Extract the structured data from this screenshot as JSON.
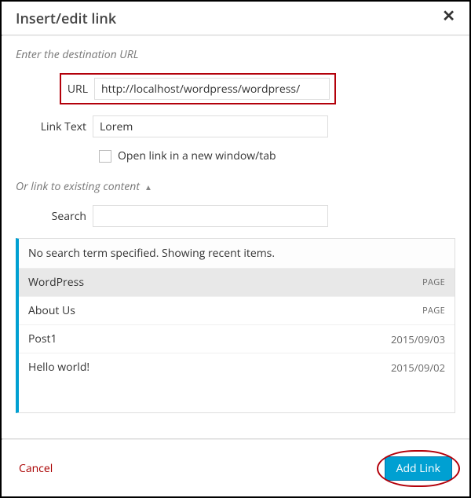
{
  "dialog": {
    "title": "Insert/edit link"
  },
  "destination": {
    "heading": "Enter the destination URL",
    "url_label": "URL",
    "url_value": "http://localhost/wordpress/wordpress/",
    "linktext_label": "Link Text",
    "linktext_value": "Lorem",
    "newtab_label": "Open link in a new window/tab",
    "newtab_checked": false
  },
  "existing": {
    "toggle_label": "Or link to existing content",
    "search_label": "Search",
    "search_value": "",
    "message": "No search term specified. Showing recent items.",
    "items": [
      {
        "title": "WordPress",
        "meta": "PAGE",
        "selected": true
      },
      {
        "title": "About Us",
        "meta": "PAGE",
        "selected": false
      },
      {
        "title": "Post1",
        "meta": "2015/09/03",
        "selected": false
      },
      {
        "title": "Hello world!",
        "meta": "2015/09/02",
        "selected": false
      }
    ]
  },
  "footer": {
    "cancel": "Cancel",
    "submit": "Add Link"
  }
}
